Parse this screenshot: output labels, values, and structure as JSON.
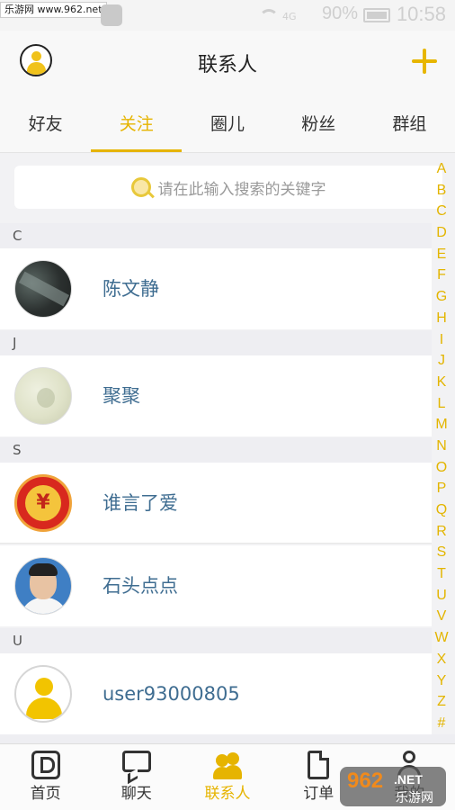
{
  "status_bar": {
    "watermark": "乐游网 www.962.net",
    "signal_label": "4G",
    "battery": "90%",
    "time": "10:58"
  },
  "header": {
    "title": "联系人"
  },
  "tabs": [
    {
      "label": "好友",
      "active": false
    },
    {
      "label": "关注",
      "active": true
    },
    {
      "label": "圈儿",
      "active": false
    },
    {
      "label": "粉丝",
      "active": false
    },
    {
      "label": "群组",
      "active": false
    }
  ],
  "search": {
    "placeholder": "请在此输入搜索的关键字"
  },
  "sections": [
    {
      "letter": "C",
      "contacts": [
        {
          "name": "陈文静"
        }
      ]
    },
    {
      "letter": "J",
      "contacts": [
        {
          "name": "聚聚"
        }
      ]
    },
    {
      "letter": "S",
      "contacts": [
        {
          "name": "谁言了爱"
        },
        {
          "name": "石头点点"
        }
      ]
    },
    {
      "letter": "U",
      "contacts": [
        {
          "name": "user93000805"
        }
      ]
    }
  ],
  "coin_avatar_symbol": "¥",
  "alphabet_index": [
    "A",
    "B",
    "C",
    "D",
    "E",
    "F",
    "G",
    "H",
    "I",
    "J",
    "K",
    "L",
    "M",
    "N",
    "O",
    "P",
    "Q",
    "R",
    "S",
    "T",
    "U",
    "V",
    "W",
    "X",
    "Y",
    "Z",
    "#"
  ],
  "bottom_nav": [
    {
      "label": "首页",
      "icon": "home-icon",
      "active": false
    },
    {
      "label": "聊天",
      "icon": "chat-icon",
      "active": false
    },
    {
      "label": "联系人",
      "icon": "contacts-icon",
      "active": true
    },
    {
      "label": "订单",
      "icon": "order-icon",
      "active": false
    },
    {
      "label": "我的",
      "icon": "me-icon",
      "active": false
    }
  ],
  "bottom_watermark": {
    "number": "962",
    "domain": ".NET",
    "site": "乐游网"
  },
  "colors": {
    "accent": "#e6b400",
    "contact_name": "#3f6d91",
    "section_bg": "#eeeef2"
  }
}
